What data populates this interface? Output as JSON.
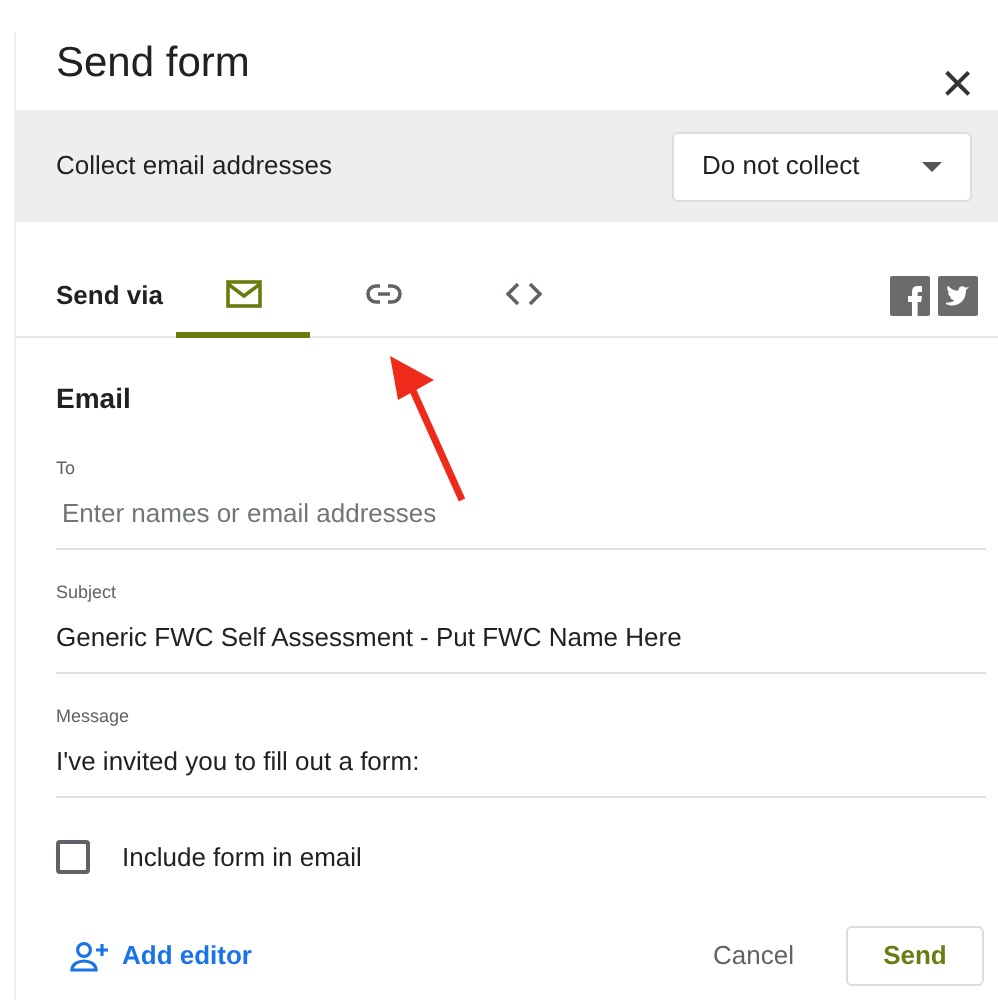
{
  "dialog": {
    "title": "Send form",
    "close": "×"
  },
  "collect": {
    "label": "Collect email addresses",
    "value": "Do not collect"
  },
  "send_via": {
    "label": "Send via",
    "tabs": [
      {
        "kind": "email",
        "selected": true
      },
      {
        "kind": "link",
        "selected": false
      },
      {
        "kind": "embed",
        "selected": false
      }
    ],
    "share": [
      {
        "kind": "facebook"
      },
      {
        "kind": "twitter"
      }
    ]
  },
  "email": {
    "heading": "Email",
    "fields": [
      {
        "label": "To",
        "placeholder": "Enter names or email addresses"
      },
      {
        "label": "Subject",
        "value": "Generic FWC Self Assessment - Put FWC Name Here"
      },
      {
        "label": "Message",
        "value": "I've invited you to fill out a form:"
      }
    ],
    "include_form": {
      "label": "Include form in email",
      "checked": false
    }
  },
  "footer": {
    "add_editor": "Add editor",
    "cancel": "Cancel",
    "send": "Send"
  }
}
